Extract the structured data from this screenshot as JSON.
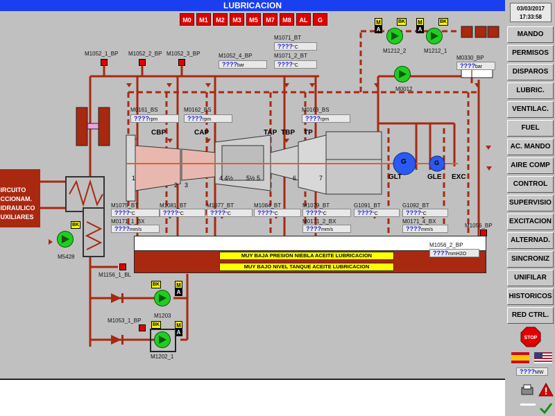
{
  "header": {
    "title": "LUBRICACION",
    "date": "03/03/2017",
    "time": "17:33:58"
  },
  "modes": [
    "M0",
    "M1",
    "M2",
    "M3",
    "M5",
    "M7",
    "M8",
    "AL",
    "G"
  ],
  "sidebar": [
    "MANDO",
    "PERMISOS",
    "DISPAROS",
    "LUBRIC.",
    "VENTILAC.",
    "FUEL",
    "AC. MANDO",
    "AIRE COMP",
    "CONTROL",
    "SUPERVISIO",
    "EXCITACION",
    "ALTERNAD.",
    "SINCRONIZ",
    "UNIFILAR",
    "HISTORICOS",
    "RED CTRL."
  ],
  "power": {
    "value": "????",
    "unit": "MW"
  },
  "circuit_label": [
    "CIRCUITO",
    "ACCIONAM.",
    "HIDRAULICO",
    "AUXILIARES"
  ],
  "alarms": [
    "MUY BAJA PRESION NIEBLA ACEITE LUBRICACION",
    "MUY BAJO NIVEL TANQUE ACEITE LUBRICACION"
  ],
  "sections": {
    "cbp": "CBP",
    "cap": "CAP",
    "tap": "TAP",
    "tbp": "TBP",
    "tp": "TP",
    "glt": "GLT",
    "gle": "GLE",
    "exc": "EXC"
  },
  "section_numbers": {
    "n1": "1",
    "n2": "2",
    "n3": "3",
    "n4": "4 4½",
    "n5": "5½ 5",
    "n6": "6",
    "n7": "7"
  },
  "generator_symbol": "G",
  "pump_tags": {
    "m1212_2": "M1212_2",
    "m1212_1": "M1212_1",
    "m0012": "M0012",
    "m5428": "M5428",
    "m1203": "M1203",
    "m1202_1": "M1202_1"
  },
  "ind": {
    "m": "M",
    "a": "A",
    "bk": "BK"
  },
  "tags": {
    "m1052_1_bp": "M1052_1_BP",
    "m1052_2_bp": "M1052_2_BP",
    "m1052_3_bp": "M1052_3_BP",
    "m1052_4_bp": "M1052_4_BP",
    "m1071_bt": "M1071_BT",
    "m1071_2_bt": "M1071_2_BT",
    "m0330_bp": "M0330_BP",
    "m0161_bs": "M0161_BS",
    "m0162_bs": "M0162_BS",
    "m0163_bs": "M0163_BS",
    "m1075_bt": "M1075_BT",
    "m1081_bt": "M1081_BT",
    "m1077_bt": "M1077_BT",
    "m1084_bt": "M1084_BT",
    "m1079_bt": "M1079_BT",
    "g1091_bt": "G1091_BT",
    "g1092_bt": "G1092_BT",
    "m0171_1_bx": "M0171_1_BX",
    "m0171_2_bx": "M0171_2_BX",
    "m0171_4_bx": "M0171_4_BX",
    "m1056_bp": "M1056_BP",
    "m1056_2_bp": "M1056_2_BP",
    "m1156_1_bl": "M1156_1_BL",
    "m1053_1_bp": "M1053_1_BP"
  },
  "values": {
    "m1052_4_bp": {
      "v": "????",
      "u": "bar"
    },
    "m1071_bt": {
      "v": "????",
      "u": "°C"
    },
    "m1071_2_bt": {
      "v": "????",
      "u": "°C"
    },
    "m0330_bp": {
      "v": "????",
      "u": "bar"
    },
    "m0161_bs": {
      "v": "????",
      "u": "rpm"
    },
    "m0162_bs": {
      "v": "????",
      "u": "rpm"
    },
    "m0163_bs": {
      "v": "????",
      "u": "rpm"
    },
    "m1075_bt": {
      "v": "????",
      "u": "°C"
    },
    "m1081_bt": {
      "v": "????",
      "u": "°C"
    },
    "m1077_bt": {
      "v": "????",
      "u": "°C"
    },
    "m1084_bt": {
      "v": "????",
      "u": "°C"
    },
    "m1079_bt": {
      "v": "????",
      "u": "°C"
    },
    "g1091_bt": {
      "v": "????",
      "u": "°C"
    },
    "g1092_bt": {
      "v": "????",
      "u": "°C"
    },
    "m0171_1_bx": {
      "v": "????",
      "u": "mm/s"
    },
    "m0171_2_bx": {
      "v": "????",
      "u": "mm/s"
    },
    "m0171_4_bx": {
      "v": "????",
      "u": "mm/s"
    },
    "m1056_2_bp": {
      "v": "????",
      "u": "mmH2O"
    }
  },
  "icons": {
    "stop": "stop-icon",
    "spain": "spain-flag-icon",
    "usa": "usa-flag-icon",
    "alarm": "alarm-triangle-icon"
  },
  "stop_label": "STOP",
  "colors": {
    "title_bar": "#1a3ff0",
    "pipe": "#a82810",
    "pump": "#22cc22",
    "alarm": "#ffff00",
    "mode_btn": "#e00000",
    "value_text": "#2020d0"
  }
}
